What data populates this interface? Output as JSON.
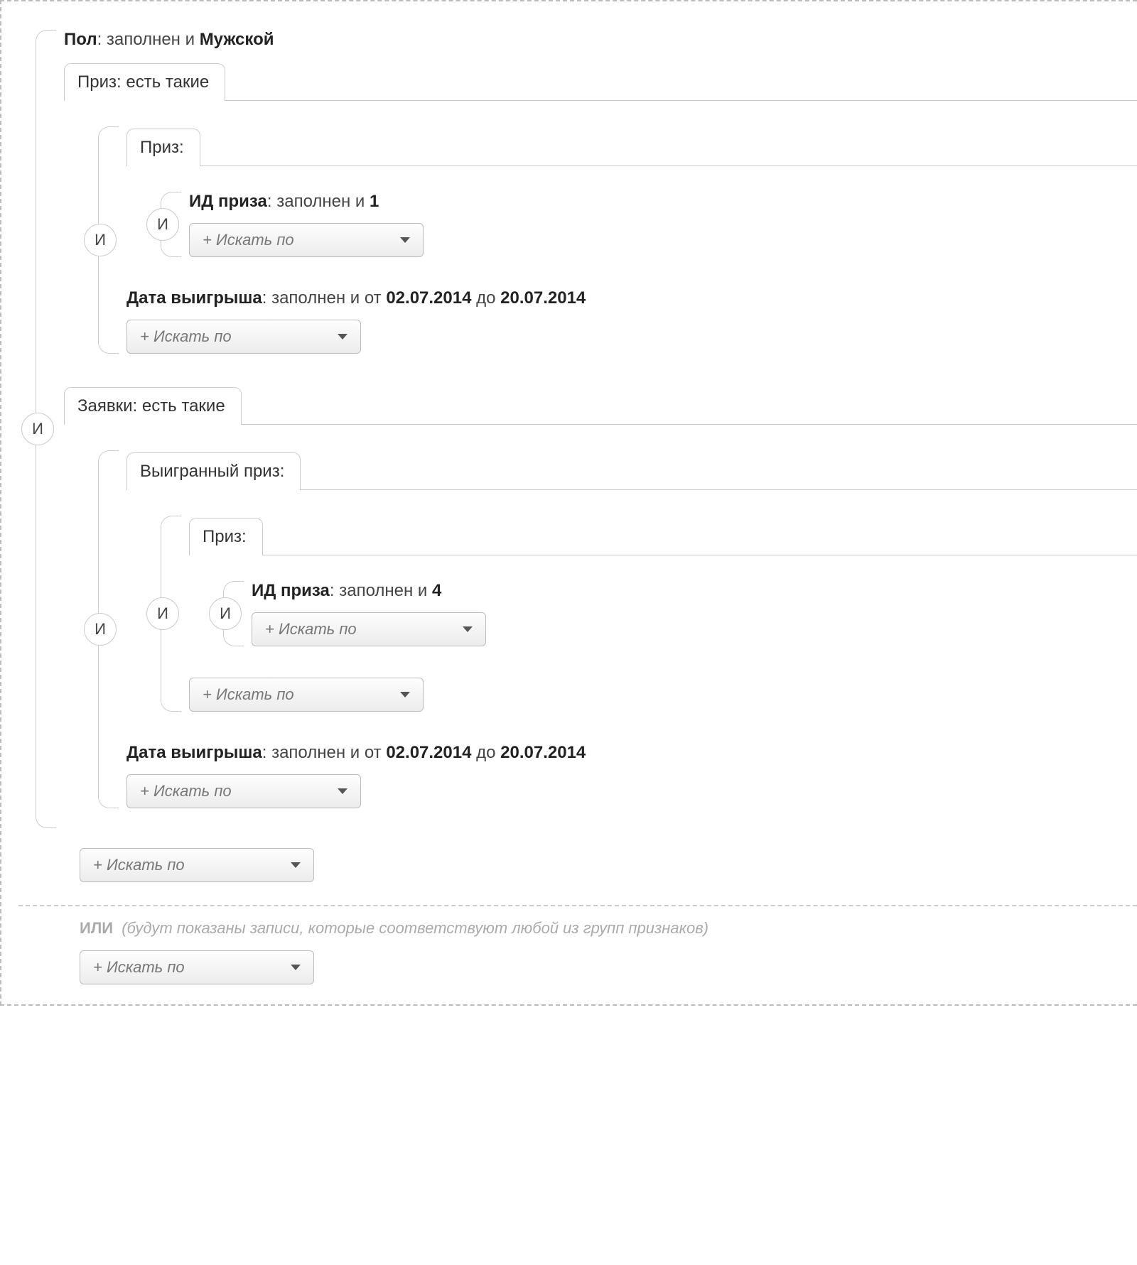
{
  "op": {
    "and": "И",
    "or": "ИЛИ"
  },
  "note": {
    "or_hint": "(будут показаны записи, которые соответствуют любой из групп признаков)"
  },
  "btn": {
    "search_by": "+ Искать по"
  },
  "c": {
    "gender_lbl": "Пол",
    "gender_sep": ": ",
    "gender_txt1": "заполнен и ",
    "gender_val": "Мужской",
    "prize_lbl": "Приз",
    "prize_sep": ": ",
    "prize_txt": "есть такие",
    "prize_sub_lbl": "Приз",
    "prize_sub_sep": ":",
    "id_prize_lbl": "ИД приза",
    "id_prize_sep": ": ",
    "id_prize_txt": "заполнен и ",
    "id_prize_val1": "1",
    "id_prize_val2": "4",
    "windate_lbl": "Дата выигрыша",
    "windate_sep": ": ",
    "windate_txt1": "заполнен и от ",
    "windate_v1": "02.07.2014",
    "windate_mid": " до ",
    "windate_v2": "20.07.2014",
    "req_lbl": "Заявки",
    "req_sep": ": ",
    "req_txt": "есть такие",
    "wonprize_lbl": "Выигранный приз",
    "wonprize_sep": ":"
  }
}
